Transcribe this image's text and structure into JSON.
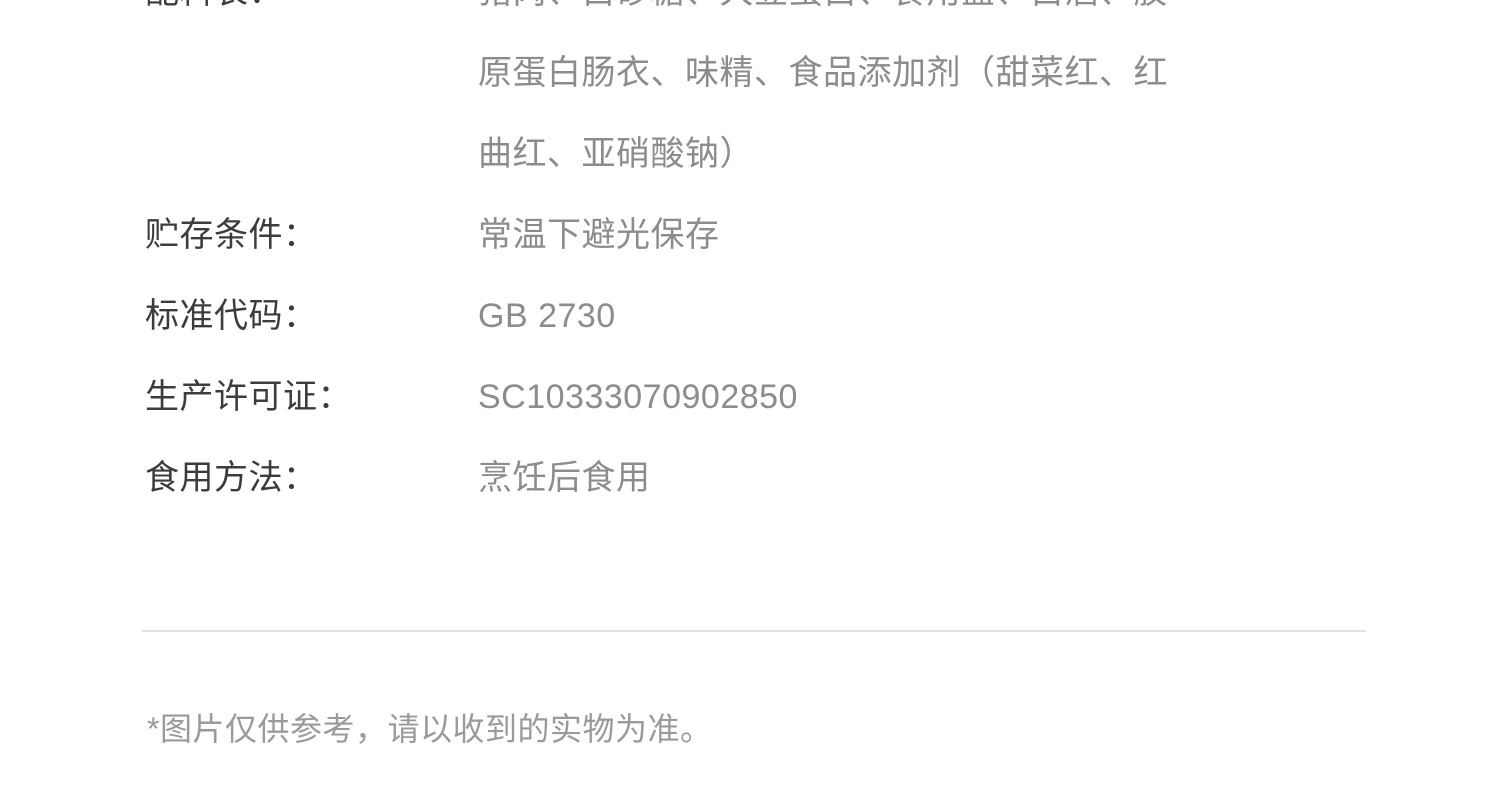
{
  "page": {
    "background_color": "#ffffff",
    "label_color": "#3c3c3c",
    "value_color": "#8c8c8c",
    "divider_color": "#e2e2e2",
    "footnote_color": "#9a9a9a"
  },
  "spec": {
    "rows": [
      {
        "label": "配料表：",
        "value_lines": [
          "猪肉、白砂糖、大豆蛋白、食用盐、白酒、胶",
          "原蛋白肠衣、味精、食品添加剂（甜菜红、红",
          "曲红、亚硝酸钠）"
        ],
        "value": "猪肉、白砂糖、大豆蛋白、食用盐、白酒、胶原蛋白肠衣、味精、食品添加剂（甜菜红、红曲红、亚硝酸钠）"
      },
      {
        "label": "贮存条件：",
        "value": "常温下避光保存"
      },
      {
        "label": "标准代码：",
        "value": "GB 2730"
      },
      {
        "label": "生产许可证：",
        "value": "SC10333070902850"
      },
      {
        "label": "食用方法：",
        "value": "烹饪后食用"
      }
    ]
  },
  "footnote": {
    "text": "*图片仅供参考，请以收到的实物为准。"
  }
}
